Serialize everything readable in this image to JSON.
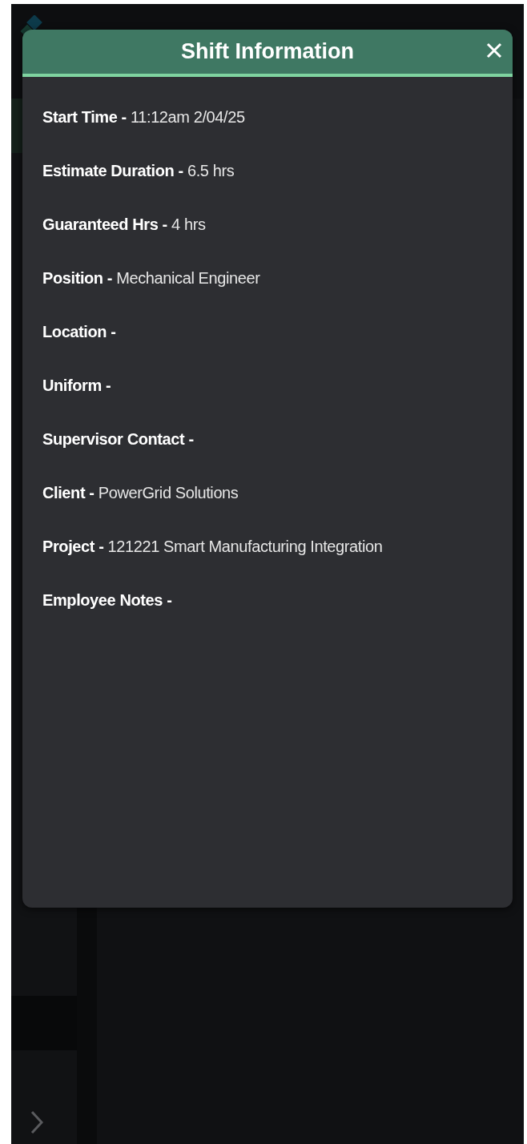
{
  "modal": {
    "title": "Shift Information",
    "fields": [
      {
        "text": "**Start Time -** 11:12am 2/04/25"
      },
      {
        "text": "**Estimate Duration -** 6.5 hrs"
      },
      {
        "text": "**Guaranteed Hrs -** 4 hrs"
      },
      {
        "text": "**Position -** Mechanical Engineer"
      },
      {
        "text": "**Location -**"
      },
      {
        "text": "**Uniform -**"
      },
      {
        "text": "**Supervisor Contact -**"
      },
      {
        "text": "**Client -** PowerGrid Solutions"
      },
      {
        "text": "**Project -** 121221 Smart Manufacturing Integration"
      },
      {
        "text": "**Employee Notes -**"
      }
    ]
  }
}
